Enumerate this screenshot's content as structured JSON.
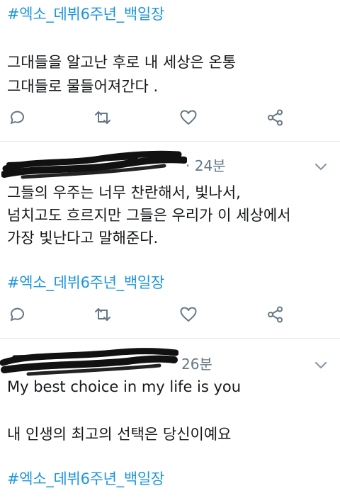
{
  "tweets": [
    {
      "hashtag": "#엑소_데뷔6주년_백일장",
      "lines": [
        "그대들을 알고난 후로 내 세상은 온통",
        "그대들로 물들어져간다 ."
      ]
    },
    {
      "time": "· 24분",
      "lines": [
        "그들의 우주는 너무 찬란해서, 빛나서,",
        "넘치고도 흐르지만 그들은 우리가 이 세상에서",
        "가장 빛난다고 말해준다."
      ],
      "hashtag": "#엑소_데뷔6주년_백일장"
    },
    {
      "time": "26분",
      "lines": [
        "My best choice in my life is you",
        "내 인생의 최고의 선택은 당신이예요"
      ],
      "hashtag": "#엑소_데뷔6주년_백일장"
    }
  ],
  "icons": {
    "reply": "reply-icon",
    "retweet": "retweet-icon",
    "like": "heart-icon",
    "share": "share-icon",
    "more": "chevron-down-icon"
  },
  "colors": {
    "hashtag": "#1b95e0",
    "text": "#14171a",
    "muted": "#657786",
    "divider": "#e1e8ed",
    "redaction": "#111111"
  }
}
